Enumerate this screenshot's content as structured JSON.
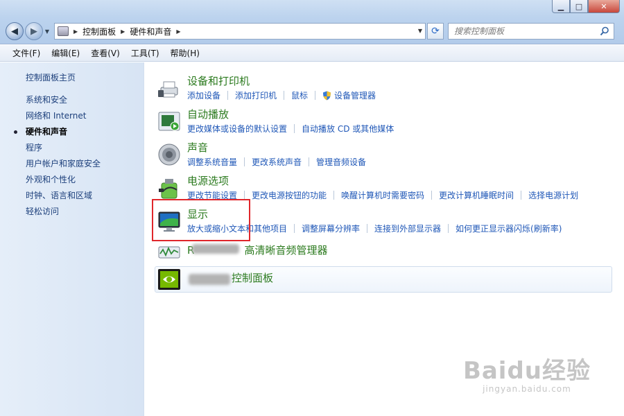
{
  "window": {
    "controls": {
      "minimize": "▁",
      "maximize": "□",
      "close": "✕"
    }
  },
  "nav": {
    "back_icon": "back-arrow-icon",
    "forward_icon": "forward-arrow-icon",
    "breadcrumb": [
      "控制面板",
      "硬件和声音"
    ],
    "search_placeholder": "搜索控制面板"
  },
  "menu": [
    "文件(F)",
    "编辑(E)",
    "查看(V)",
    "工具(T)",
    "帮助(H)"
  ],
  "sidebar": {
    "home": "控制面板主页",
    "items": [
      {
        "label": "系统和安全",
        "active": false
      },
      {
        "label": "网络和 Internet",
        "active": false
      },
      {
        "label": "硬件和声音",
        "active": true
      },
      {
        "label": "程序",
        "active": false
      },
      {
        "label": "用户帐户和家庭安全",
        "active": false
      },
      {
        "label": "外观和个性化",
        "active": false
      },
      {
        "label": "时钟、语言和区域",
        "active": false
      },
      {
        "label": "轻松访问",
        "active": false
      }
    ]
  },
  "categories": [
    {
      "title": "设备和打印机",
      "icon": "printer-icon",
      "links": [
        "添加设备",
        "添加打印机",
        "鼠标",
        "设备管理器"
      ]
    },
    {
      "title": "自动播放",
      "icon": "autoplay-icon",
      "links": [
        "更改媒体或设备的默认设置",
        "自动播放 CD 或其他媒体"
      ]
    },
    {
      "title": "声音",
      "icon": "speaker-icon",
      "links": [
        "调整系统音量",
        "更改系统声音",
        "管理音频设备"
      ]
    },
    {
      "title": "电源选项",
      "icon": "power-options-icon",
      "links": [
        "更改节能设置",
        "更改电源按钮的功能",
        "唤醒计算机时需要密码",
        "更改计算机睡眠时间",
        "选择电源计划"
      ]
    },
    {
      "title": "显示",
      "icon": "display-monitor-icon",
      "links": [
        "放大或缩小文本和其他项目",
        "调整屏幕分辨率",
        "连接到外部显示器",
        "如何更正显示器闪烁(刷新率)"
      ]
    }
  ],
  "audio_manager": {
    "prefix": "R",
    "title": "高清晰音频管理器"
  },
  "nvidia_panel": {
    "title": "控制面板"
  },
  "watermark": {
    "line1": "Baidu经验",
    "line2": "jingyan.baidu.com"
  },
  "colors": {
    "category_title": "#2b7a1e",
    "link": "#1f57b7",
    "highlight": "#e0262b"
  }
}
